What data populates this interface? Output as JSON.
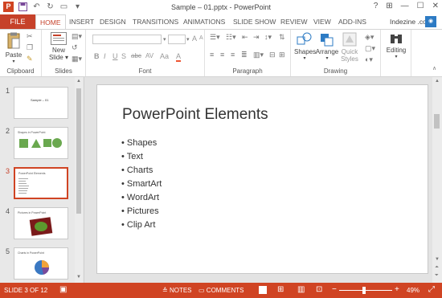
{
  "window": {
    "title": "Sample – 01.pptx - PowerPoint",
    "app_logo_letter": "P",
    "controls": [
      "?",
      "⊞",
      "—",
      "☐",
      "✕"
    ]
  },
  "tabs": {
    "file": "FILE",
    "items": [
      "HOME",
      "INSERT",
      "DESIGN",
      "TRANSITIONS",
      "ANIMATIONS",
      "SLIDE SHOW",
      "REVIEW",
      "VIEW",
      "ADD-INS"
    ],
    "active": "HOME",
    "user": "Indezine .com"
  },
  "ribbon": {
    "clipboard": {
      "label": "Clipboard",
      "paste": "Paste"
    },
    "slides": {
      "label": "Slides",
      "new_slide_line1": "New",
      "new_slide_line2": "Slide"
    },
    "font": {
      "label": "Font",
      "format_buttons": [
        "B",
        "I",
        "U",
        "S",
        "abc",
        "AV",
        "Aa",
        "A"
      ]
    },
    "paragraph": {
      "label": "Paragraph"
    },
    "drawing": {
      "label": "Drawing",
      "shapes": "Shapes",
      "arrange": "Arrange",
      "quick_styles_line1": "Quick",
      "quick_styles_line2": "Styles"
    },
    "editing": {
      "label": "Editing"
    }
  },
  "thumbnails": [
    {
      "number": "1",
      "caption": "Sample – 01"
    },
    {
      "number": "2",
      "caption": "Shapes in PowerPoint"
    },
    {
      "number": "3",
      "caption": "PowerPoint Elements"
    },
    {
      "number": "4",
      "caption": "Pictures in PowerPoint"
    },
    {
      "number": "5",
      "caption": "Charts in PowerPoint"
    }
  ],
  "slide": {
    "title": "PowerPoint Elements",
    "bullets": [
      "Shapes",
      "Text",
      "Charts",
      "SmartArt",
      "WordArt",
      "Pictures",
      "Clip Art"
    ]
  },
  "status": {
    "slide_counter": "SLIDE 3 OF 12",
    "notes": "NOTES",
    "comments": "COMMENTS",
    "zoom_minus": "−",
    "zoom_plus": "+",
    "zoom": "49%",
    "zoom_value": 49
  },
  "colors": {
    "accent": "#d04423",
    "file_tab": "#c6412a"
  }
}
